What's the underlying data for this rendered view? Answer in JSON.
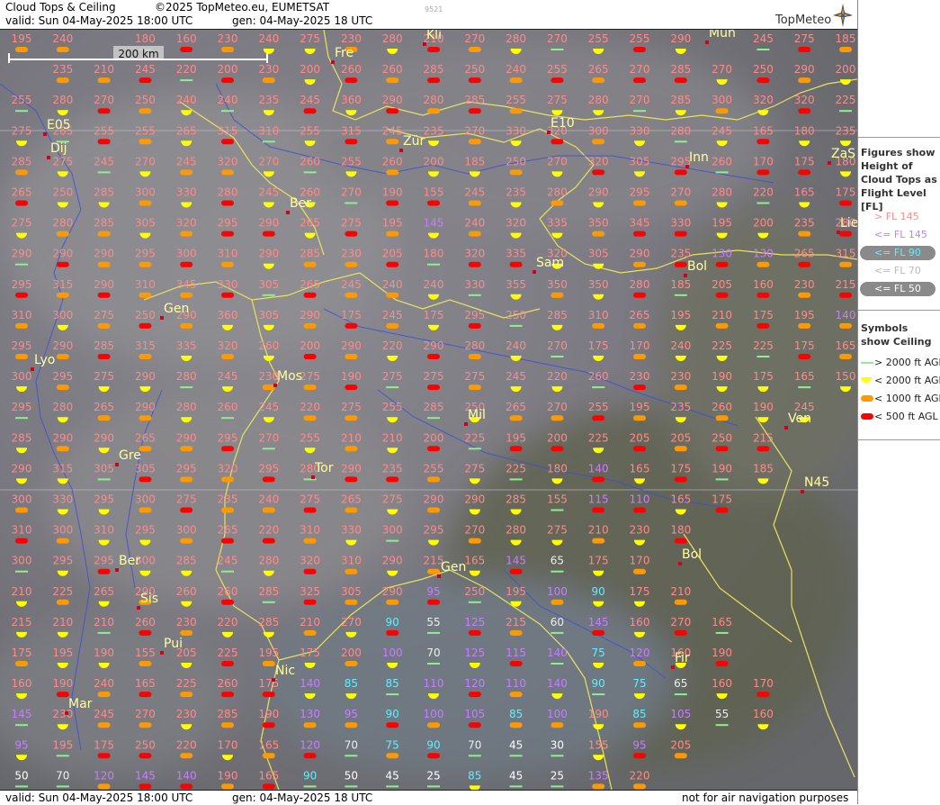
{
  "header": {
    "title": "Cloud Tops & Ceiling",
    "copyright": "©2025 TopMeteo.eu, EUMETSAT",
    "valid": "valid:  Sun  04-May-2025  18:00 UTC",
    "generated": "gen: 04-May-2025 18 UTC",
    "id_code": "9521",
    "logo": "TopMeteo"
  },
  "footer": {
    "valid": "valid:  Sun  04-May-2025  18:00 UTC",
    "generated": "gen: 04-May-2025 18 UTC",
    "disclaimer": "not for air navigation purposes"
  },
  "scale_bar": {
    "label": "200 km"
  },
  "legend": {
    "figures_title": "Figures show Height of Cloud Tops as Flight Level  [FL]",
    "figures": [
      {
        "label": "> FL 145",
        "color": "#ff8a8a",
        "style": "plain"
      },
      {
        "label": "<= FL 145",
        "color": "#c77dff",
        "style": "plain"
      },
      {
        "label": "<= FL 90",
        "color": "#5ff0ff",
        "style": "pill"
      },
      {
        "label": "<= FL 70",
        "color": "#bbbbbb",
        "style": "plain"
      },
      {
        "label": "<= FL 50",
        "color": "#ffffff",
        "style": "pill"
      }
    ],
    "symbols_title": "Symbols show Ceiling",
    "symbols": [
      {
        "label": "> 2000 ft AGL",
        "color": "#90ee90",
        "shape": "line"
      },
      {
        "label": "< 2000 ft AGL",
        "color": "#ffff00",
        "shape": "half"
      },
      {
        "label": "< 1000 ft AGL",
        "color": "#ff9900",
        "shape": "pill"
      },
      {
        "label": "< 500 ft AGL",
        "color": "#ff0000",
        "shape": "pill"
      }
    ]
  },
  "grid": {
    "values": [
      [
        195,
        240,
        null,
        180,
        160,
        230,
        240,
        275,
        230,
        280,
        210,
        270,
        280,
        270,
        255,
        255,
        290,
        null,
        245,
        275,
        185
      ],
      [
        null,
        235,
        210,
        245,
        220,
        200,
        230,
        200,
        260,
        260,
        285,
        250,
        240,
        255,
        265,
        270,
        285,
        270,
        250,
        290,
        200,
        225
      ],
      [
        255,
        280,
        270,
        250,
        240,
        240,
        235,
        245,
        360,
        290,
        280,
        285,
        255,
        275,
        280,
        270,
        285,
        300,
        320,
        320,
        225
      ],
      [
        275,
        265,
        255,
        255,
        265,
        315,
        310,
        255,
        315,
        245,
        235,
        270,
        330,
        320,
        300,
        330,
        280,
        245,
        165,
        180,
        235
      ],
      [
        285,
        275,
        245,
        270,
        245,
        320,
        270,
        260,
        255,
        260,
        200,
        185,
        250,
        270,
        320,
        305,
        295,
        260,
        170,
        175,
        180,
        175
      ],
      [
        265,
        250,
        285,
        300,
        330,
        280,
        245,
        260,
        270,
        190,
        155,
        245,
        235,
        280,
        290,
        295,
        270,
        280,
        220,
        165,
        175
      ],
      [
        275,
        280,
        285,
        305,
        320,
        295,
        290,
        265,
        275,
        195,
        145,
        240,
        320,
        335,
        350,
        345,
        330,
        195,
        200,
        235,
        280
      ],
      [
        290,
        290,
        290,
        295,
        300,
        310,
        290,
        285,
        230,
        205,
        180,
        320,
        335,
        320,
        305,
        290,
        235,
        130,
        130,
        265,
        315
      ],
      [
        295,
        315,
        290,
        310,
        345,
        330,
        305,
        265,
        245,
        240,
        240,
        330,
        355,
        350,
        350,
        280,
        185,
        205,
        160,
        230,
        215
      ],
      [
        310,
        300,
        275,
        250,
        290,
        360,
        305,
        290,
        175,
        245,
        175,
        295,
        250,
        285,
        310,
        265,
        195,
        210,
        175,
        195,
        140
      ],
      [
        295,
        290,
        285,
        315,
        335,
        320,
        260,
        200,
        290,
        220,
        290,
        280,
        240,
        270,
        175,
        170,
        240,
        225,
        225,
        175,
        165
      ],
      [
        300,
        295,
        275,
        290,
        280,
        245,
        230,
        275,
        190,
        275,
        275,
        275,
        245,
        220,
        260,
        230,
        230,
        190,
        175,
        165,
        150
      ],
      [
        295,
        280,
        265,
        290,
        280,
        260,
        245,
        220,
        275,
        255,
        285,
        250,
        265,
        270,
        255,
        195,
        235,
        260,
        190,
        245
      ],
      [
        285,
        290,
        290,
        265,
        290,
        295,
        270,
        255,
        210,
        210,
        200,
        225,
        195,
        200,
        225,
        205,
        205,
        250,
        215
      ],
      [
        290,
        315,
        305,
        305,
        295,
        320,
        295,
        280,
        290,
        235,
        255,
        275,
        225,
        180,
        140,
        165,
        175,
        190,
        185
      ],
      [
        300,
        330,
        295,
        300,
        275,
        235,
        240,
        275,
        265,
        275,
        290,
        290,
        285,
        155,
        115,
        110,
        165,
        175
      ],
      [
        310,
        300,
        310,
        295,
        300,
        265,
        220,
        310,
        330,
        300,
        295,
        270,
        280,
        275,
        210,
        230,
        180
      ],
      [
        300,
        295,
        295,
        300,
        285,
        245,
        280,
        320,
        310,
        290,
        215,
        165,
        145,
        65,
        175,
        170
      ],
      [
        210,
        225,
        265,
        290,
        260,
        260,
        285,
        325,
        305,
        290,
        95,
        250,
        195,
        100,
        90,
        175,
        210
      ],
      [
        215,
        210,
        210,
        260,
        230,
        220,
        285,
        210,
        270,
        90,
        55,
        125,
        215,
        60,
        145,
        160,
        270,
        165
      ],
      [
        175,
        195,
        190,
        155,
        205,
        225,
        195,
        175,
        200,
        100,
        70,
        125,
        115,
        140,
        75,
        120,
        160,
        190
      ],
      [
        160,
        190,
        240,
        165,
        225,
        260,
        175,
        140,
        85,
        85,
        110,
        120,
        110,
        140,
        90,
        75,
        65,
        160,
        170
      ],
      [
        145,
        230,
        245,
        270,
        230,
        285,
        190,
        130,
        95,
        90,
        100,
        105,
        85,
        100,
        190,
        85,
        105,
        55,
        160
      ],
      [
        95,
        195,
        175,
        250,
        220,
        170,
        165,
        120,
        70,
        75,
        90,
        70,
        45,
        30,
        155,
        95,
        205
      ],
      [
        50,
        70,
        120,
        145,
        140,
        190,
        165,
        90,
        50,
        45,
        25,
        85,
        45,
        25,
        135,
        220
      ]
    ]
  },
  "places": [
    {
      "name": "Fre"
    },
    {
      "name": "Kli"
    },
    {
      "name": "Mun"
    },
    {
      "name": "E05"
    },
    {
      "name": "E10"
    },
    {
      "name": "Dij"
    },
    {
      "name": "Zür"
    },
    {
      "name": "Inn"
    },
    {
      "name": "ZaS"
    },
    {
      "name": "Ber"
    },
    {
      "name": "Lie"
    },
    {
      "name": "Sam"
    },
    {
      "name": "Bol"
    },
    {
      "name": "Gen"
    },
    {
      "name": "Lyo"
    },
    {
      "name": "Mos"
    },
    {
      "name": "Mil"
    },
    {
      "name": "Ven"
    },
    {
      "name": "Gre"
    },
    {
      "name": "Tor"
    },
    {
      "name": "N45"
    },
    {
      "name": "Ber"
    },
    {
      "name": "Gen"
    },
    {
      "name": "Bol"
    },
    {
      "name": "Sis"
    },
    {
      "name": "Pui"
    },
    {
      "name": "Nic"
    },
    {
      "name": "Fir"
    },
    {
      "name": "Mar"
    }
  ]
}
